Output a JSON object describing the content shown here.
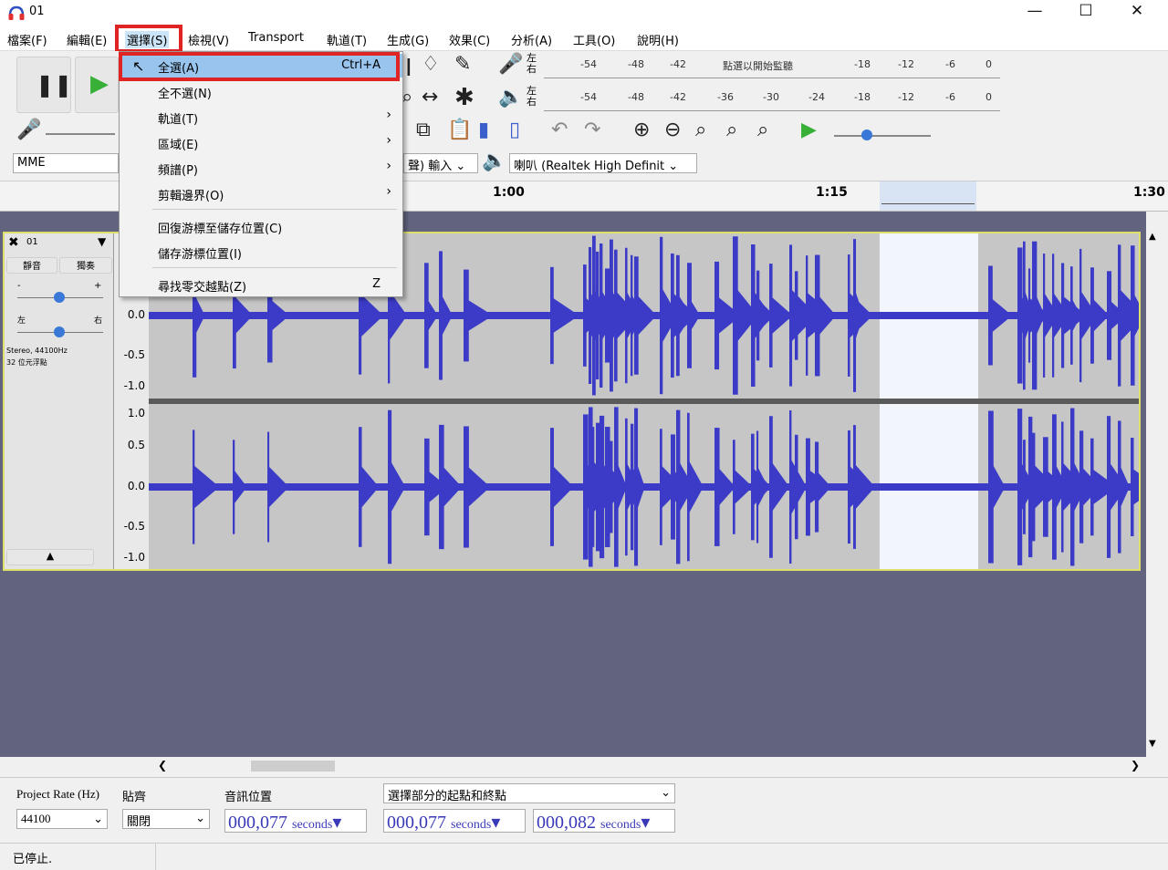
{
  "window": {
    "title": "01",
    "minimize_icon": "minimize-icon",
    "maximize_icon": "maximize-icon",
    "close_icon": "close-icon"
  },
  "menubar": {
    "items": [
      "檔案(F)",
      "編輯(E)",
      "選擇(S)",
      "檢視(V)",
      "Transport",
      "軌道(T)",
      "生成(G)",
      "效果(C)",
      "分析(A)",
      "工具(O)",
      "說明(H)"
    ],
    "active_index": 2
  },
  "select_menu": {
    "items": [
      {
        "label": "全選(A)",
        "shortcut": "Ctrl+A",
        "submenu": false,
        "highlighted": true
      },
      {
        "label": "全不選(N)",
        "shortcut": "",
        "submenu": false
      },
      {
        "label": "軌道(T)",
        "shortcut": "",
        "submenu": true
      },
      {
        "label": "區域(E)",
        "shortcut": "",
        "submenu": true
      },
      {
        "label": "頻譜(P)",
        "shortcut": "",
        "submenu": true
      },
      {
        "label": "剪輯邊界(O)",
        "shortcut": "",
        "submenu": true
      },
      {
        "label": "回復游標至儲存位置(C)",
        "shortcut": "",
        "submenu": false
      },
      {
        "label": "儲存游標位置(I)",
        "shortcut": "",
        "submenu": false
      },
      {
        "label": "尋找零交越點(Z)",
        "shortcut": "Z",
        "submenu": false
      }
    ]
  },
  "toolbar": {
    "record_meter_ticks": [
      "-54",
      "-48",
      "-42",
      "點選以開始監聽",
      "-18",
      "-12",
      "-6",
      "0"
    ],
    "play_meter_ticks": [
      "-54",
      "-48",
      "-42",
      "-36",
      "-30",
      "-24",
      "-18",
      "-12",
      "-6",
      "0"
    ],
    "lr_label_left": "左",
    "lr_label_right": "右",
    "host": "MME",
    "input_device": "聲) 輸入",
    "output_device": "喇叭 (Realtek High Definit"
  },
  "timeline": {
    "labels": [
      "1:00",
      "1:15",
      "1:30"
    ]
  },
  "track": {
    "name": "01",
    "mute_label": "靜音",
    "solo_label": "獨奏",
    "gain_minus": "-",
    "gain_plus": "+",
    "pan_left": "左",
    "pan_right": "右",
    "info_line1": "Stereo, 44100Hz",
    "info_line2": "32 位元浮點",
    "scale_top": [
      "0.0",
      "-0.5",
      "-1.0"
    ],
    "scale_bottom": [
      "1.0",
      "0.5",
      "0.0",
      "-0.5",
      "-1.0"
    ],
    "waveform_color": "#3b3bc8",
    "selection_color": "#f2f5fb"
  },
  "bottom": {
    "project_rate_label": "Project Rate (Hz)",
    "project_rate_value": "44100",
    "snap_label": "貼齊",
    "snap_value": "關閉",
    "audio_position_label": "音訊位置",
    "audio_position_value": "000,077",
    "selection_mode": "選擇部分的起點和終點",
    "selection_start": "000,077",
    "selection_end": "000,082",
    "unit": "seconds"
  },
  "status": {
    "text": "已停止."
  },
  "colors": {
    "highlight_box": "#e02424",
    "track_bg": "#62647f",
    "menu_highlight": "#99c4ee"
  }
}
